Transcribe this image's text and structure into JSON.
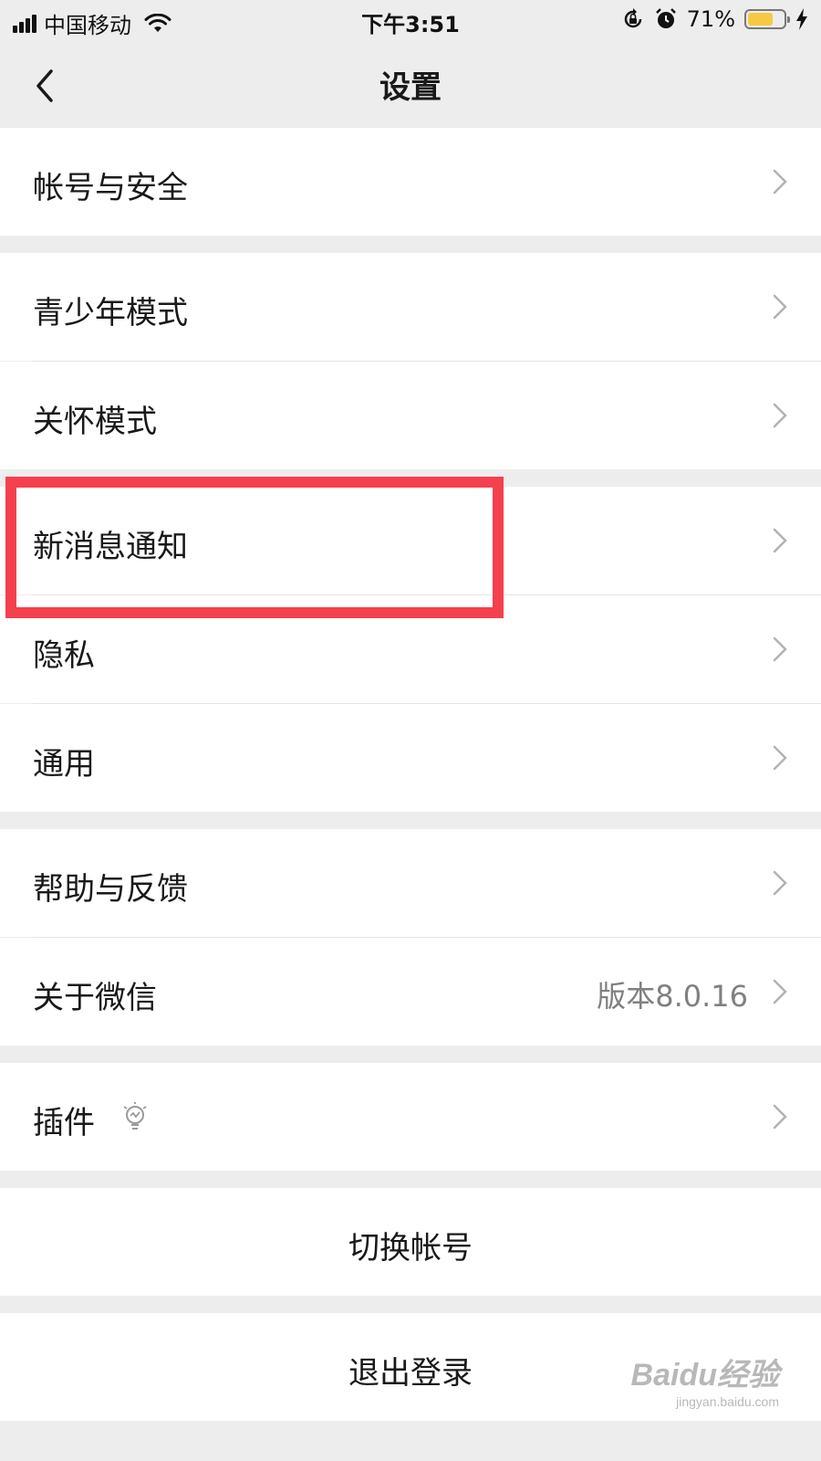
{
  "status_bar": {
    "carrier": "中国移动",
    "time": "下午3:51",
    "battery_percent": "71%",
    "battery_level": 0.71,
    "icons": [
      "signal-icon",
      "wifi-icon",
      "rotation-lock-icon",
      "alarm-icon",
      "battery-icon",
      "charging-icon"
    ]
  },
  "nav": {
    "title": "设置",
    "back_icon": "chevron-left-icon"
  },
  "groups": {
    "account": {
      "label": "帐号与安全"
    },
    "youth": {
      "label": "青少年模式"
    },
    "care": {
      "label": "关怀模式"
    },
    "notify": {
      "label": "新消息通知"
    },
    "privacy": {
      "label": "隐私"
    },
    "general": {
      "label": "通用"
    },
    "help": {
      "label": "帮助与反馈"
    },
    "about": {
      "label": "关于微信",
      "value": "版本8.0.16"
    },
    "plugins": {
      "label": "插件",
      "icon": "lightbulb-icon"
    }
  },
  "actions": {
    "switch_account": "切换帐号",
    "logout": "退出登录"
  },
  "annotation": {
    "highlight_color": "#f5404e",
    "highlighted_item": "新消息通知"
  },
  "colors": {
    "background": "#ededed",
    "cell": "#ffffff",
    "text": "#191919",
    "secondary_text": "#808080",
    "chevron": "#b2b2b2",
    "battery": "#f7c844"
  },
  "watermark": {
    "logo": "Baidu经验",
    "url": "jingyan.baidu.com"
  }
}
